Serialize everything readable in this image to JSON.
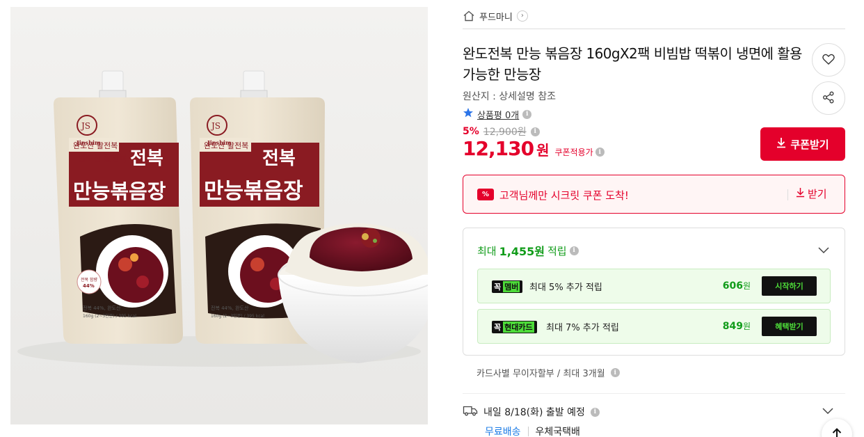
{
  "breadcrumb": {
    "seller": "푸드마니"
  },
  "product": {
    "title": "완도전복 만능 볶음장 160gX2팩 비빔밥 떡볶이 냉면에 활용가능한 만능장",
    "origin": "원산지 : 상세설명 참조",
    "review_label": "상품평 0개",
    "discount_rate": "5%",
    "original_price": "12,900원",
    "sale_price": "12,130",
    "currency": "원",
    "coupon_applied": "쿠폰적용가"
  },
  "package_art": {
    "brand": "Jinshim",
    "origin_line": "완도산 활전복",
    "product_name_1": "전복",
    "product_name_2": "만능볶음장",
    "detail_1": "전복 44%, 완도산",
    "detail_2": "160g (2~3인분) / 395 kcal",
    "sticker_1": "전복 함량",
    "sticker_2": "44%"
  },
  "actions": {
    "coupon_button": "쿠폰받기"
  },
  "secret_coupon": {
    "tag": "%",
    "message": "고객님께만 시크릿 쿠폰 도착!",
    "get_label": "받기"
  },
  "points": {
    "prefix": "최대",
    "amount": "1,455원",
    "suffix": "적립",
    "rows": [
      {
        "badge_k": "꼭",
        "badge_name": "멤버",
        "desc": "최대 5% 추가 적립",
        "points": "606",
        "unit": "원",
        "action": "시작하기"
      },
      {
        "badge_k": "꼭",
        "badge_name": "현대카드",
        "desc": "최대 7% 추가 적립",
        "points": "849",
        "unit": "원",
        "action": "혜택받기"
      }
    ]
  },
  "installment": "카드사별 무이자할부 / 최대 3개월",
  "delivery": {
    "schedule": "내일 8/18(화) 출발 예정",
    "shipping_fee": "무료배송",
    "carrier": "우체국택배"
  },
  "colors": {
    "accent_red": "#e4002b",
    "point_green": "#119c1a",
    "member_green": "#4ddc39",
    "link_blue": "#1b7be6"
  },
  "icons": [
    "home-icon",
    "chevron-right-icon",
    "heart-icon",
    "share-icon",
    "star-icon",
    "info-icon",
    "download-icon",
    "chevron-down-icon",
    "truck-icon",
    "arrow-up-icon"
  ]
}
